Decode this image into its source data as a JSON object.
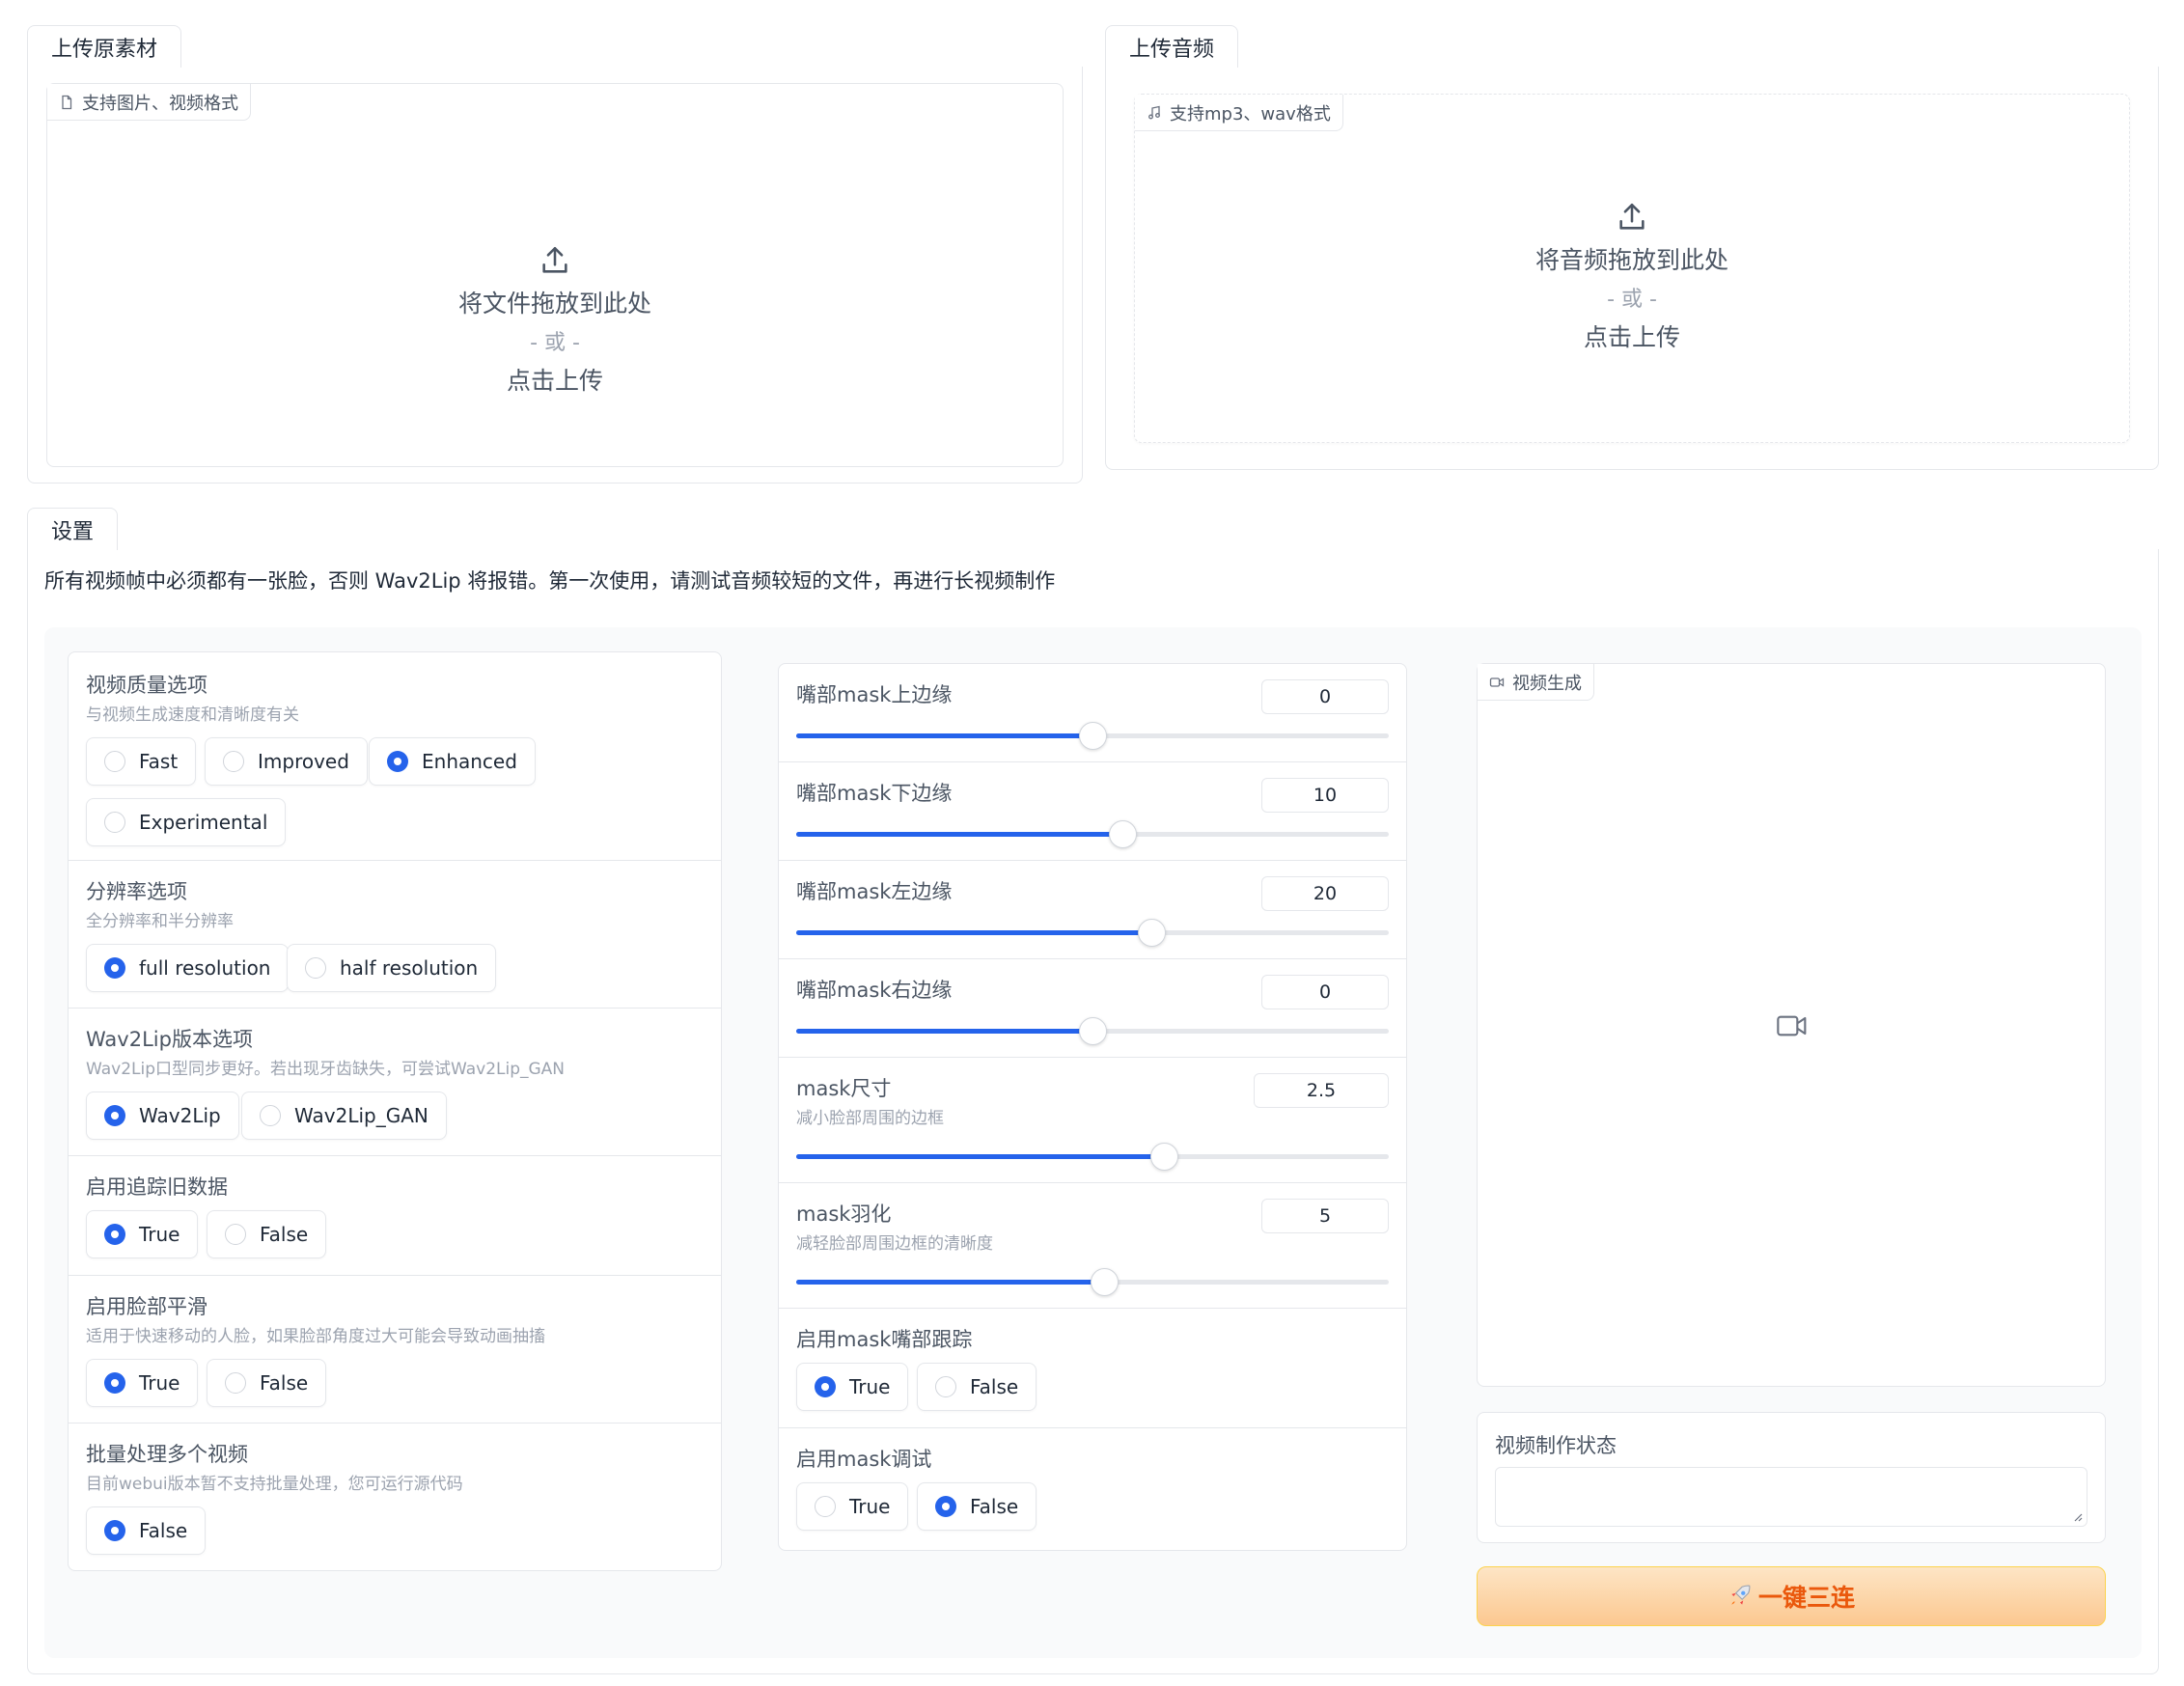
{
  "upload_material": {
    "tab": "上传原素材",
    "chip": "支持图片、视频格式",
    "drop_text": "将文件拖放到此处",
    "or_text": "- 或 -",
    "click_text": "点击上传"
  },
  "upload_audio": {
    "tab": "上传音频",
    "chip": "支持mp3、wav格式",
    "drop_text": "将音频拖放到此处",
    "or_text": "- 或 -",
    "click_text": "点击上传"
  },
  "settings": {
    "tab": "设置",
    "notice": "所有视频帧中必须都有一张脸，否则 Wav2Lip 将报错。第一次使用，请测试音频较短的文件，再进行长视频制作"
  },
  "left_panel": {
    "quality": {
      "title": "视频质量选项",
      "info": "与视频生成速度和清晰度有关",
      "options": [
        "Fast",
        "Improved",
        "Enhanced",
        "Experimental"
      ],
      "selected": "Enhanced"
    },
    "resolution": {
      "title": "分辨率选项",
      "info": "全分辨率和半分辨率",
      "options": [
        "full resolution",
        "half resolution"
      ],
      "selected": "full resolution"
    },
    "version": {
      "title": "Wav2Lip版本选项",
      "info": "Wav2Lip口型同步更好。若出现牙齿缺失，可尝试Wav2Lip_GAN",
      "options": [
        "Wav2Lip",
        "Wav2Lip_GAN"
      ],
      "selected": "Wav2Lip"
    },
    "tracking": {
      "title": "启用追踪旧数据",
      "options": [
        "True",
        "False"
      ],
      "selected": "True"
    },
    "smooth": {
      "title": "启用脸部平滑",
      "info": "适用于快速移动的人脸，如果脸部角度过大可能会导致动画抽搐",
      "options": [
        "True",
        "False"
      ],
      "selected": "True"
    },
    "batch": {
      "title": "批量处理多个视频",
      "info": "目前webui版本暂不支持批量处理，您可运行源代码",
      "options": [
        "False"
      ],
      "selected": "False"
    }
  },
  "sliders": {
    "top": {
      "label": "嘴部mask上边缘",
      "value": "0",
      "fraction": 0.5
    },
    "bottom": {
      "label": "嘴部mask下边缘",
      "value": "10",
      "fraction": 0.55
    },
    "left": {
      "label": "嘴部mask左边缘",
      "value": "20",
      "fraction": 0.6
    },
    "right": {
      "label": "嘴部mask右边缘",
      "value": "0",
      "fraction": 0.5
    },
    "size": {
      "label": "mask尺寸",
      "info": "减小脸部周围的边框",
      "value": "2.5",
      "fraction": 0.62
    },
    "feather": {
      "label": "mask羽化",
      "info": "减轻脸部周围边框的清晰度",
      "value": "5",
      "fraction": 0.52
    }
  },
  "mouth_tracking": {
    "title": "启用mask嘴部跟踪",
    "options": [
      "True",
      "False"
    ],
    "selected": "True"
  },
  "mask_debug": {
    "title": "启用mask调试",
    "options": [
      "True",
      "False"
    ],
    "selected": "False"
  },
  "output": {
    "video_chip": "视频生成",
    "status_title": "视频制作状态",
    "run_button": "一键三连",
    "run_icon": "rocket-icon"
  },
  "colors": {
    "accent": "#2563eb",
    "button_text": "#ea580c"
  }
}
